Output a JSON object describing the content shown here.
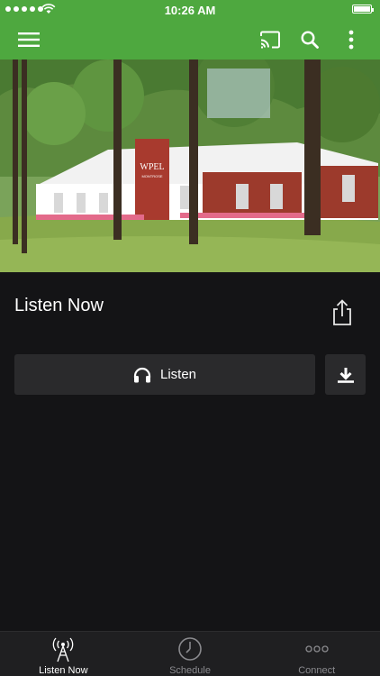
{
  "status_bar": {
    "time": "10:26 AM",
    "signal_dots": 5
  },
  "app_bar": {
    "background": "#4ea83f",
    "menu_icon": "hamburger-menu-icon",
    "actions": [
      {
        "icon": "cast-icon"
      },
      {
        "icon": "search-icon"
      },
      {
        "icon": "more-vertical-icon"
      }
    ]
  },
  "hero": {
    "sign_text": "WPEL",
    "sign_subtext": "MONTROSE"
  },
  "main": {
    "title": "Listen Now",
    "listen_label": "Listen",
    "listen_icon": "headphones-icon",
    "download_icon": "download-icon",
    "share_icon": "share-icon"
  },
  "tabs": [
    {
      "label": "Listen Now",
      "icon": "radio-tower-icon",
      "active": true
    },
    {
      "label": "Schedule",
      "icon": "clock-icon",
      "active": false
    },
    {
      "label": "Connect",
      "icon": "more-dots-icon",
      "active": false
    }
  ]
}
